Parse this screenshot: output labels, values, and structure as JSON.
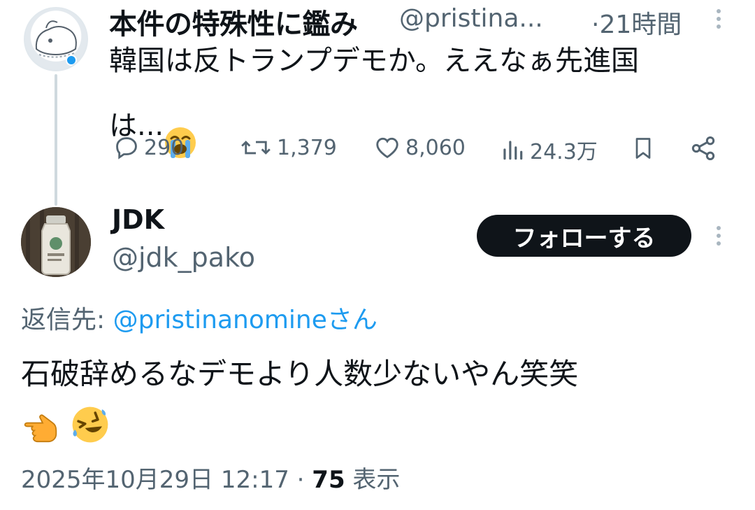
{
  "parent_tweet": {
    "author_name": "本件の特殊性に鑑み",
    "handle": "@pristina...",
    "time": "·21時間",
    "text": "韓国は反トランプデモか。ええなぁ先進国\nは...",
    "emoji": "loudly-crying-face-emoji",
    "stats": {
      "replies": "290",
      "retweets": "1,379",
      "likes": "8,060",
      "views": "24.3万"
    }
  },
  "reply_tweet": {
    "author_name": "JDK",
    "handle": "@jdk_pako",
    "follow_label": "フォローする",
    "reply_to_label": "返信先:",
    "reply_to_mention": "@pristinanomine",
    "reply_to_suffix": "さん",
    "text": "石破辞めるなデモより人数少ないやん笑笑",
    "emojis": [
      "backhand-index-pointing-left-emoji",
      "rolling-on-the-floor-laughing-emoji"
    ],
    "timestamp": "2025年10月29日 12:17 · ",
    "view_count": "75",
    "view_label": " 表示"
  },
  "colors": {
    "text": "#0f1419",
    "secondary": "#536471",
    "link": "#1d9bf0",
    "button_bg": "#0f1419",
    "thread_line": "#cfd9de"
  }
}
